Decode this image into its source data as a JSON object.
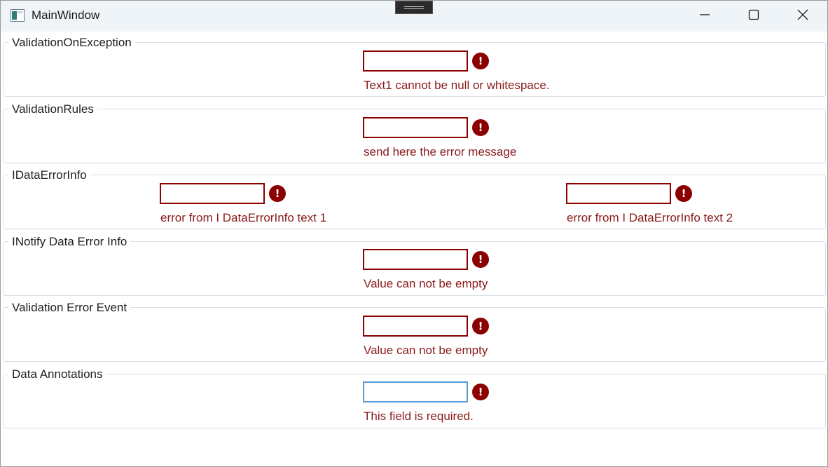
{
  "window": {
    "title": "MainWindow"
  },
  "groups": [
    {
      "header": "ValidationOnException",
      "message": "Text1 cannot be null or whitespace."
    },
    {
      "header": "ValidationRules",
      "message": "send here the error message"
    },
    {
      "header": "IDataErrorInfo",
      "message1": "error from I DataErrorInfo text 1",
      "message2": "error from I DataErrorInfo text 2"
    },
    {
      "header": "INotify Data Error Info",
      "message": "Value can not be empty"
    },
    {
      "header": "Validation Error Event",
      "message": "Value can not be empty"
    },
    {
      "header": "Data Annotations",
      "message": "This field is required."
    }
  ],
  "error_icon_glyph": "!",
  "colors": {
    "error": "#8b0000",
    "focus": "#5b9bd5",
    "titlebar": "#eff4f9"
  }
}
